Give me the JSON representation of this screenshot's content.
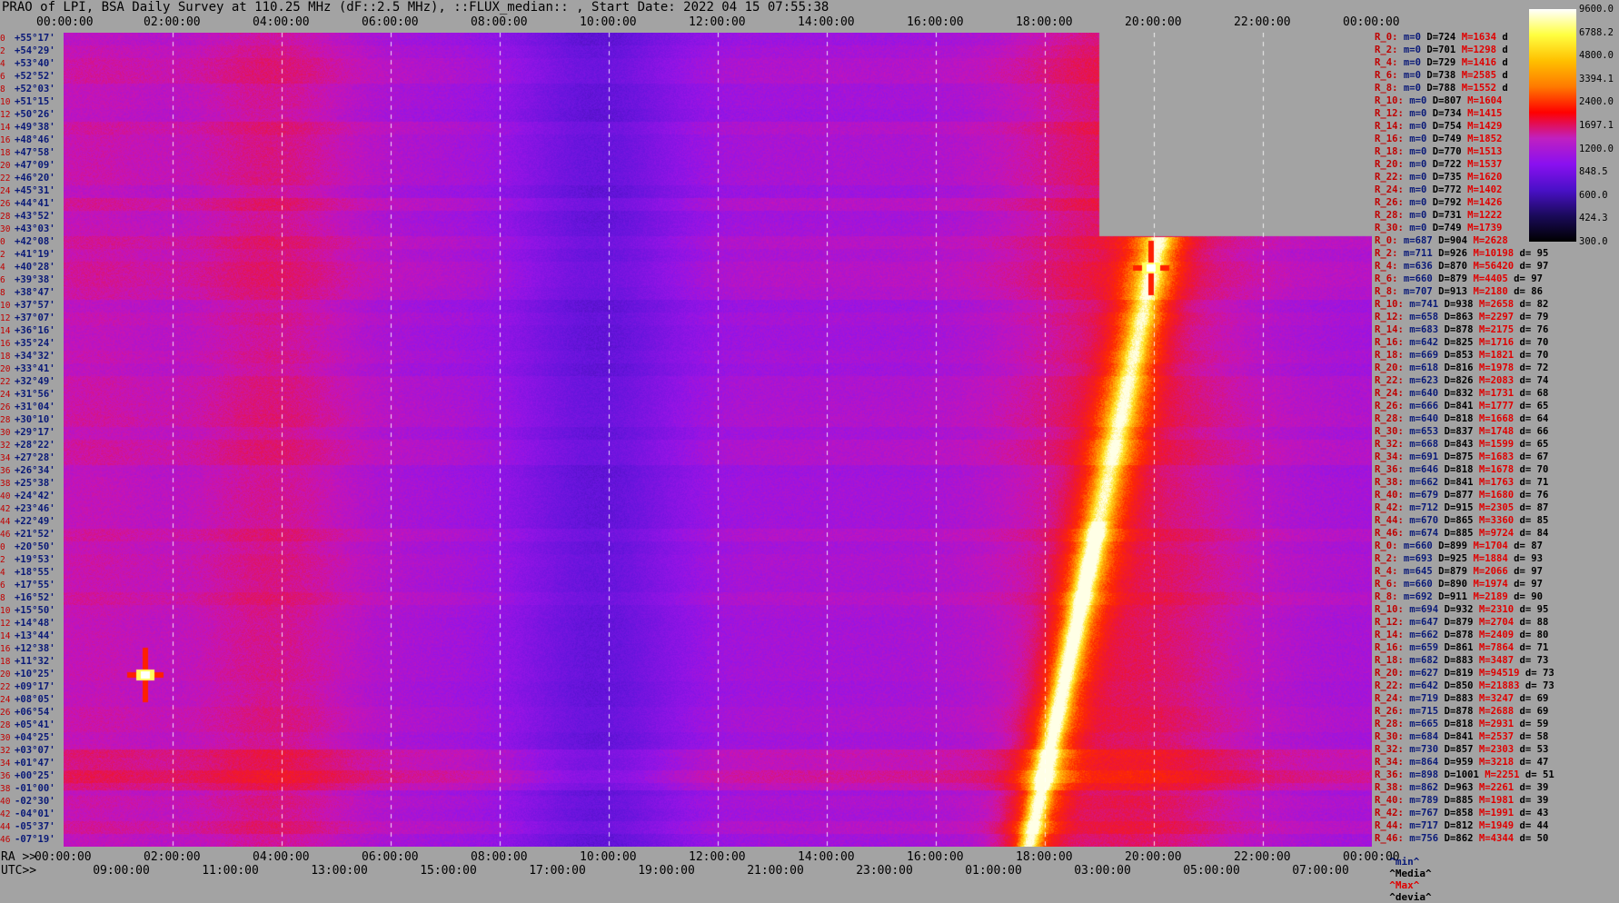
{
  "title": "PRAO of LPI, BSA Daily Survey at 110.25 MHz (dF::2.5 MHz), ::FLUX_median:: , Start Date: 2022 04 15 07:55:38",
  "top_axis_ticks": [
    "00:00:00",
    "02:00:00",
    "04:00:00",
    "06:00:00",
    "08:00:00",
    "10:00:00",
    "12:00:00",
    "14:00:00",
    "16:00:00",
    "18:00:00",
    "20:00:00",
    "22:00:00",
    "00:00:00"
  ],
  "bottom_axis": {
    "ra_label": "RA >>",
    "utc_label": "UTC>>",
    "ra_ticks": [
      "00:00:00",
      "02:00:00",
      "04:00:00",
      "06:00:00",
      "08:00:00",
      "10:00:00",
      "12:00:00",
      "14:00:00",
      "16:00:00",
      "18:00:00",
      "20:00:00",
      "22:00:00",
      "00:00:00"
    ],
    "utc_ticks": [
      "09:00:00",
      "11:00:00",
      "13:00:00",
      "15:00:00",
      "17:00:00",
      "19:00:00",
      "21:00:00",
      "23:00:00",
      "01:00:00",
      "03:00:00",
      "05:00:00",
      "07:00:00"
    ]
  },
  "declination_rows": [
    {
      "idx": "0",
      "dec": "+55°17'"
    },
    {
      "idx": "2",
      "dec": "+54°29'"
    },
    {
      "idx": "4",
      "dec": "+53°40'"
    },
    {
      "idx": "6",
      "dec": "+52°52'"
    },
    {
      "idx": "8",
      "dec": "+52°03'"
    },
    {
      "idx": "10",
      "dec": "+51°15'"
    },
    {
      "idx": "12",
      "dec": "+50°26'"
    },
    {
      "idx": "14",
      "dec": "+49°38'"
    },
    {
      "idx": "16",
      "dec": "+48°46'"
    },
    {
      "idx": "18",
      "dec": "+47°58'"
    },
    {
      "idx": "20",
      "dec": "+47°09'"
    },
    {
      "idx": "22",
      "dec": "+46°20'"
    },
    {
      "idx": "24",
      "dec": "+45°31'"
    },
    {
      "idx": "26",
      "dec": "+44°41'"
    },
    {
      "idx": "28",
      "dec": "+43°52'"
    },
    {
      "idx": "30",
      "dec": "+43°03'"
    },
    {
      "idx": "0",
      "dec": "+42°08'"
    },
    {
      "idx": "2",
      "dec": "+41°19'"
    },
    {
      "idx": "4",
      "dec": "+40°28'"
    },
    {
      "idx": "6",
      "dec": "+39°38'"
    },
    {
      "idx": "8",
      "dec": "+38°47'"
    },
    {
      "idx": "10",
      "dec": "+37°57'"
    },
    {
      "idx": "12",
      "dec": "+37°07'"
    },
    {
      "idx": "14",
      "dec": "+36°16'"
    },
    {
      "idx": "16",
      "dec": "+35°24'"
    },
    {
      "idx": "18",
      "dec": "+34°32'"
    },
    {
      "idx": "20",
      "dec": "+33°41'"
    },
    {
      "idx": "22",
      "dec": "+32°49'"
    },
    {
      "idx": "24",
      "dec": "+31°56'"
    },
    {
      "idx": "26",
      "dec": "+31°04'"
    },
    {
      "idx": "28",
      "dec": "+30°10'"
    },
    {
      "idx": "30",
      "dec": "+29°17'"
    },
    {
      "idx": "32",
      "dec": "+28°22'"
    },
    {
      "idx": "34",
      "dec": "+27°28'"
    },
    {
      "idx": "36",
      "dec": "+26°34'"
    },
    {
      "idx": "38",
      "dec": "+25°38'"
    },
    {
      "idx": "40",
      "dec": "+24°42'"
    },
    {
      "idx": "42",
      "dec": "+23°46'"
    },
    {
      "idx": "44",
      "dec": "+22°49'"
    },
    {
      "idx": "46",
      "dec": "+21°52'"
    },
    {
      "idx": "0",
      "dec": "+20°50'"
    },
    {
      "idx": "2",
      "dec": "+19°53'"
    },
    {
      "idx": "4",
      "dec": "+18°55'"
    },
    {
      "idx": "6",
      "dec": "+17°55'"
    },
    {
      "idx": "8",
      "dec": "+16°52'"
    },
    {
      "idx": "10",
      "dec": "+15°50'"
    },
    {
      "idx": "12",
      "dec": "+14°48'"
    },
    {
      "idx": "14",
      "dec": "+13°44'"
    },
    {
      "idx": "16",
      "dec": "+12°38'"
    },
    {
      "idx": "18",
      "dec": "+11°32'"
    },
    {
      "idx": "20",
      "dec": "+10°25'"
    },
    {
      "idx": "22",
      "dec": "+09°17'"
    },
    {
      "idx": "24",
      "dec": "+08°05'"
    },
    {
      "idx": "26",
      "dec": "+06°54'"
    },
    {
      "idx": "28",
      "dec": "+05°41'"
    },
    {
      "idx": "30",
      "dec": "+04°25'"
    },
    {
      "idx": "32",
      "dec": "+03°07'"
    },
    {
      "idx": "34",
      "dec": "+01°47'"
    },
    {
      "idx": "36",
      "dec": "+00°25'"
    },
    {
      "idx": "38",
      "dec": "-01°00'"
    },
    {
      "idx": "40",
      "dec": "-02°30'"
    },
    {
      "idx": "42",
      "dec": "-04°01'"
    },
    {
      "idx": "44",
      "dec": "-05°37'"
    },
    {
      "idx": "46",
      "dec": "-07°19'"
    }
  ],
  "stats_rows": [
    {
      "r": "R_0:",
      "m": "m=0",
      "D": "D=724",
      "M": "M=1634",
      "dv": "d"
    },
    {
      "r": "R_2:",
      "m": "m=0",
      "D": "D=701",
      "M": "M=1298",
      "dv": "d"
    },
    {
      "r": "R_4:",
      "m": "m=0",
      "D": "D=729",
      "M": "M=1416",
      "dv": "d"
    },
    {
      "r": "R_6:",
      "m": "m=0",
      "D": "D=738",
      "M": "M=2585",
      "dv": "d"
    },
    {
      "r": "R_8:",
      "m": "m=0",
      "D": "D=788",
      "M": "M=1552",
      "dv": "d"
    },
    {
      "r": "R_10:",
      "m": "m=0",
      "D": "D=807",
      "M": "M=1604",
      "dv": ""
    },
    {
      "r": "R_12:",
      "m": "m=0",
      "D": "D=734",
      "M": "M=1415",
      "dv": ""
    },
    {
      "r": "R_14:",
      "m": "m=0",
      "D": "D=754",
      "M": "M=1429",
      "dv": ""
    },
    {
      "r": "R_16:",
      "m": "m=0",
      "D": "D=749",
      "M": "M=1852",
      "dv": ""
    },
    {
      "r": "R_18:",
      "m": "m=0",
      "D": "D=770",
      "M": "M=1513",
      "dv": ""
    },
    {
      "r": "R_20:",
      "m": "m=0",
      "D": "D=722",
      "M": "M=1537",
      "dv": ""
    },
    {
      "r": "R_22:",
      "m": "m=0",
      "D": "D=735",
      "M": "M=1620",
      "dv": ""
    },
    {
      "r": "R_24:",
      "m": "m=0",
      "D": "D=772",
      "M": "M=1402",
      "dv": ""
    },
    {
      "r": "R_26:",
      "m": "m=0",
      "D": "D=792",
      "M": "M=1426",
      "dv": ""
    },
    {
      "r": "R_28:",
      "m": "m=0",
      "D": "D=731",
      "M": "M=1222",
      "dv": ""
    },
    {
      "r": "R_30:",
      "m": "m=0",
      "D": "D=749",
      "M": "M=1739",
      "dv": ""
    },
    {
      "r": "R_0:",
      "m": "m=687",
      "D": "D=904",
      "M": "M=2628",
      "dv": ""
    },
    {
      "r": "R_2:",
      "m": "m=711",
      "D": "D=926",
      "M": "M=10198",
      "dv": "d= 95"
    },
    {
      "r": "R_4:",
      "m": "m=636",
      "D": "D=870",
      "M": "M=56420",
      "dv": "d= 97"
    },
    {
      "r": "R_6:",
      "m": "m=660",
      "D": "D=879",
      "M": "M=4405",
      "dv": "d= 97"
    },
    {
      "r": "R_8:",
      "m": "m=707",
      "D": "D=913",
      "M": "M=2180",
      "dv": "d= 86"
    },
    {
      "r": "R_10:",
      "m": "m=741",
      "D": "D=938",
      "M": "M=2658",
      "dv": "d= 82"
    },
    {
      "r": "R_12:",
      "m": "m=658",
      "D": "D=863",
      "M": "M=2297",
      "dv": "d= 79"
    },
    {
      "r": "R_14:",
      "m": "m=683",
      "D": "D=878",
      "M": "M=2175",
      "dv": "d= 76"
    },
    {
      "r": "R_16:",
      "m": "m=642",
      "D": "D=825",
      "M": "M=1716",
      "dv": "d= 70"
    },
    {
      "r": "R_18:",
      "m": "m=669",
      "D": "D=853",
      "M": "M=1821",
      "dv": "d= 70"
    },
    {
      "r": "R_20:",
      "m": "m=618",
      "D": "D=816",
      "M": "M=1978",
      "dv": "d= 72"
    },
    {
      "r": "R_22:",
      "m": "m=623",
      "D": "D=826",
      "M": "M=2083",
      "dv": "d= 74"
    },
    {
      "r": "R_24:",
      "m": "m=640",
      "D": "D=832",
      "M": "M=1731",
      "dv": "d= 68"
    },
    {
      "r": "R_26:",
      "m": "m=666",
      "D": "D=841",
      "M": "M=1777",
      "dv": "d= 65"
    },
    {
      "r": "R_28:",
      "m": "m=640",
      "D": "D=818",
      "M": "M=1668",
      "dv": "d= 64"
    },
    {
      "r": "R_30:",
      "m": "m=653",
      "D": "D=837",
      "M": "M=1748",
      "dv": "d= 66"
    },
    {
      "r": "R_32:",
      "m": "m=668",
      "D": "D=843",
      "M": "M=1599",
      "dv": "d= 65"
    },
    {
      "r": "R_34:",
      "m": "m=691",
      "D": "D=875",
      "M": "M=1683",
      "dv": "d= 67"
    },
    {
      "r": "R_36:",
      "m": "m=646",
      "D": "D=818",
      "M": "M=1678",
      "dv": "d= 70"
    },
    {
      "r": "R_38:",
      "m": "m=662",
      "D": "D=841",
      "M": "M=1763",
      "dv": "d= 71"
    },
    {
      "r": "R_40:",
      "m": "m=679",
      "D": "D=877",
      "M": "M=1680",
      "dv": "d= 76"
    },
    {
      "r": "R_42:",
      "m": "m=712",
      "D": "D=915",
      "M": "M=2305",
      "dv": "d= 87"
    },
    {
      "r": "R_44:",
      "m": "m=670",
      "D": "D=865",
      "M": "M=3360",
      "dv": "d= 85"
    },
    {
      "r": "R_46:",
      "m": "m=674",
      "D": "D=885",
      "M": "M=9724",
      "dv": "d= 84"
    },
    {
      "r": "R_0:",
      "m": "m=660",
      "D": "D=899",
      "M": "M=1704",
      "dv": "d= 87"
    },
    {
      "r": "R_2:",
      "m": "m=693",
      "D": "D=925",
      "M": "M=1884",
      "dv": "d= 93"
    },
    {
      "r": "R_4:",
      "m": "m=645",
      "D": "D=879",
      "M": "M=2066",
      "dv": "d= 97"
    },
    {
      "r": "R_6:",
      "m": "m=660",
      "D": "D=890",
      "M": "M=1974",
      "dv": "d= 97"
    },
    {
      "r": "R_8:",
      "m": "m=692",
      "D": "D=911",
      "M": "M=2189",
      "dv": "d= 90"
    },
    {
      "r": "R_10:",
      "m": "m=694",
      "D": "D=932",
      "M": "M=2310",
      "dv": "d= 95"
    },
    {
      "r": "R_12:",
      "m": "m=647",
      "D": "D=879",
      "M": "M=2704",
      "dv": "d= 88"
    },
    {
      "r": "R_14:",
      "m": "m=662",
      "D": "D=878",
      "M": "M=2409",
      "dv": "d= 80"
    },
    {
      "r": "R_16:",
      "m": "m=659",
      "D": "D=861",
      "M": "M=7864",
      "dv": "d= 71"
    },
    {
      "r": "R_18:",
      "m": "m=682",
      "D": "D=883",
      "M": "M=3487",
      "dv": "d= 73"
    },
    {
      "r": "R_20:",
      "m": "m=627",
      "D": "D=819",
      "M": "M=94519",
      "dv": "d= 73"
    },
    {
      "r": "R_22:",
      "m": "m=642",
      "D": "D=850",
      "M": "M=21883",
      "dv": "d= 73"
    },
    {
      "r": "R_24:",
      "m": "m=719",
      "D": "D=883",
      "M": "M=3247",
      "dv": "d= 69"
    },
    {
      "r": "R_26:",
      "m": "m=715",
      "D": "D=878",
      "M": "M=2688",
      "dv": "d= 69"
    },
    {
      "r": "R_28:",
      "m": "m=665",
      "D": "D=818",
      "M": "M=2931",
      "dv": "d= 59"
    },
    {
      "r": "R_30:",
      "m": "m=684",
      "D": "D=841",
      "M": "M=2537",
      "dv": "d= 58"
    },
    {
      "r": "R_32:",
      "m": "m=730",
      "D": "D=857",
      "M": "M=2303",
      "dv": "d= 53"
    },
    {
      "r": "R_34:",
      "m": "m=864",
      "D": "D=959",
      "M": "M=3218",
      "dv": "d= 47"
    },
    {
      "r": "R_36:",
      "m": "m=898",
      "D": "D=1001",
      "M": "M=2251",
      "dv": "d= 51"
    },
    {
      "r": "R_38:",
      "m": "m=862",
      "D": "D=963",
      "M": "M=2261",
      "dv": "d= 39"
    },
    {
      "r": "R_40:",
      "m": "m=789",
      "D": "D=885",
      "M": "M=1981",
      "dv": "d= 39"
    },
    {
      "r": "R_42:",
      "m": "m=767",
      "D": "D=858",
      "M": "M=1991",
      "dv": "d= 43"
    },
    {
      "r": "R_44:",
      "m": "m=717",
      "D": "D=812",
      "M": "M=1949",
      "dv": "d= 44"
    },
    {
      "r": "R_46:",
      "m": "m=756",
      "D": "D=862",
      "M": "M=4344",
      "dv": "d= 50"
    }
  ],
  "stats_legend": {
    "min": "^min^",
    "media": "^Media^",
    "max": "^Max^",
    "devia": "^devia^"
  },
  "colorbar": {
    "ticks": [
      "9600.0",
      "6788.2",
      "4800.0",
      "3394.1",
      "2400.0",
      "1697.1",
      "1200.0",
      "848.5",
      "600.0",
      "424.3",
      "300.0"
    ],
    "colors": [
      "#000000",
      "#1a0a5a",
      "#4a10c8",
      "#8a10f0",
      "#c020c0",
      "#ff0000",
      "#ff7a00",
      "#ffc000",
      "#ffff40",
      "#ffffff"
    ]
  },
  "chart_data": {
    "type": "heatmap",
    "title": "PRAO of LPI, BSA Daily Survey at 110.25 MHz (dF::2.5 MHz), ::FLUX_median:: , Start Date: 2022 04 15 07:55:38",
    "x_axis_top": "RA (sidereal time) 00:00:00 – 24:00:00",
    "x_axis_bottom": "UTC 08:00 – 08:00",
    "y_axis": "Declination +55°17' to -07°19' (64 beams)",
    "value_range": [
      300.0,
      9600.0
    ],
    "colorbar_log": true,
    "missing_block": {
      "x_from_hours": 19.0,
      "x_to_hours": 24.0,
      "rows_from": 0,
      "rows_to": 15
    },
    "bright_features": [
      {
        "name": "source at RA~01:30",
        "ra_hours": 1.5,
        "dec": "+10°25'",
        "value": 94519
      },
      {
        "name": "source at RA~19:55",
        "ra_hours": 19.95,
        "dec": "+40°28'",
        "value": 56420
      },
      {
        "name": "diagonal sun/interference track",
        "from_ra_hours": 17.7,
        "from_dec": "-07°19'",
        "to_ra_hours": 20.3,
        "to_dec": "+42°08'"
      }
    ]
  }
}
